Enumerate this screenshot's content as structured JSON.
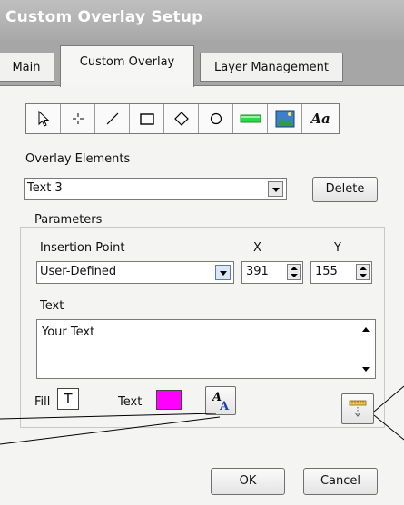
{
  "window": {
    "title": "Custom Overlay Setup"
  },
  "tabs": [
    {
      "label": "Main"
    },
    {
      "label": "Custom Overlay"
    },
    {
      "label": "Layer Management"
    }
  ],
  "toolbar": {
    "tools": [
      "pointer-icon",
      "crosshair-icon",
      "line-icon",
      "rectangle-icon",
      "diamond-icon",
      "ellipse-icon",
      "color-bar-icon",
      "image-icon",
      "text-icon"
    ],
    "text_tool_glyph": "Aa"
  },
  "overlay_elements": {
    "label": "Overlay Elements",
    "selected": "Text 3",
    "delete_label": "Delete"
  },
  "parameters": {
    "title": "Parameters",
    "insertion_point_label": "Insertion Point",
    "insertion_point_value": "User-Defined",
    "x_label": "X",
    "x_value": "391",
    "y_label": "Y",
    "y_value": "155",
    "text_label": "Text",
    "text_value": "Your Text",
    "fill_label": "Fill",
    "fill_glyph": "T",
    "text_color_label": "Text",
    "text_color": "#ff00ff"
  },
  "footer": {
    "ok_label": "OK",
    "cancel_label": "Cancel"
  }
}
